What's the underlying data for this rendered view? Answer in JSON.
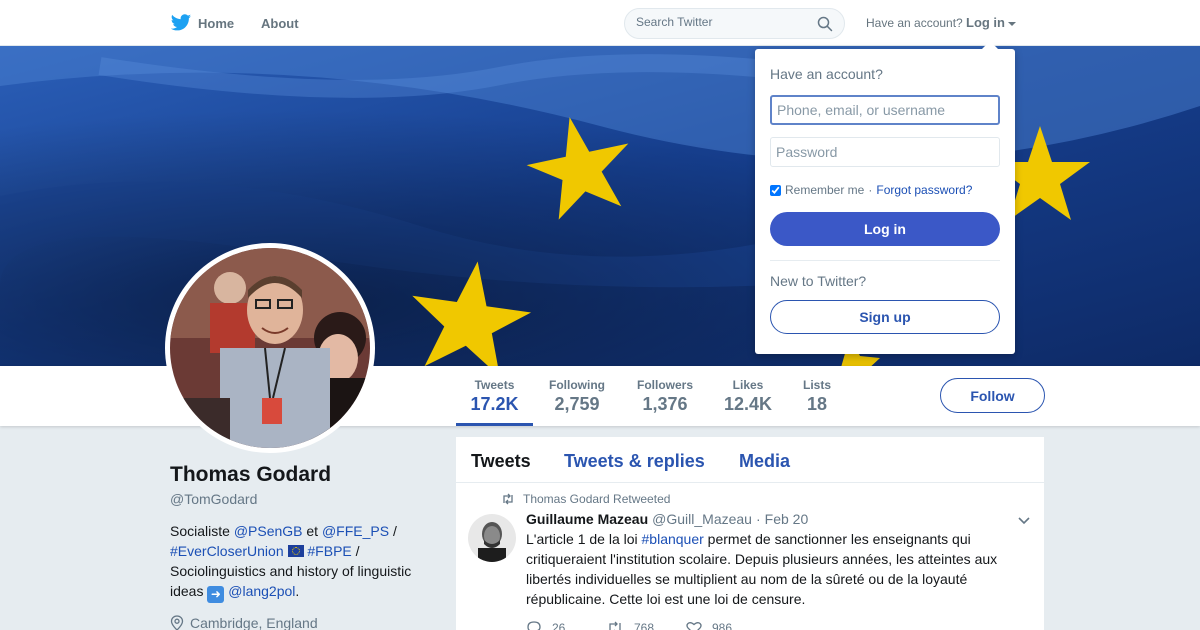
{
  "topbar": {
    "home_label": "Home",
    "about_label": "About",
    "search_placeholder": "Search Twitter",
    "have_account": "Have an account?",
    "login_label": "Log in",
    "brand_color": "#1da1f2"
  },
  "profile": {
    "name": "Thomas Godard",
    "handle": "@TomGodard",
    "bio": {
      "t1": "Socialiste ",
      "m1": "@PSenGB",
      "t2": " et ",
      "m2": "@FFE_PS",
      "t3": " / ",
      "h1": "#EverCloserUnion",
      "h2": "#FBPE",
      "t4": " / Sociolinguistics and history of linguistic ideas ",
      "m3": "@lang2pol",
      "t5": "."
    },
    "location": "Cambridge, England"
  },
  "stats": [
    {
      "label": "Tweets",
      "value": "17.2K"
    },
    {
      "label": "Following",
      "value": "2,759"
    },
    {
      "label": "Followers",
      "value": "1,376"
    },
    {
      "label": "Likes",
      "value": "12.4K"
    },
    {
      "label": "Lists",
      "value": "18"
    }
  ],
  "follow_label": "Follow",
  "timeline": {
    "tabs": [
      "Tweets",
      "Tweets & replies",
      "Media"
    ],
    "tweet": {
      "retweeted_by": "Thomas Godard Retweeted",
      "author_name": "Guillaume Mazeau",
      "author_handle": "@Guill_Mazeau",
      "dot": "·",
      "date": "Feb 20",
      "text_1": "L'article 1 de la loi ",
      "hashtag": "#blanquer",
      "text_2": " permet de sanctionner les enseignants qui critiqueraient l'institution scolaire. Depuis plusieurs années, les atteintes aux libertés individuelles se multiplient au nom de la sûreté ou de la loyauté républicaine. Cette loi est une loi de censure.",
      "replies": "26",
      "retweets": "768",
      "likes": "986"
    }
  },
  "login_dropdown": {
    "title": "Have an account?",
    "username_placeholder": "Phone, email, or username",
    "password_placeholder": "Password",
    "remember": "Remember me",
    "sep": "·",
    "forgot": "Forgot password?",
    "login_button": "Log in",
    "new_to": "New to Twitter?",
    "signup_button": "Sign up"
  }
}
